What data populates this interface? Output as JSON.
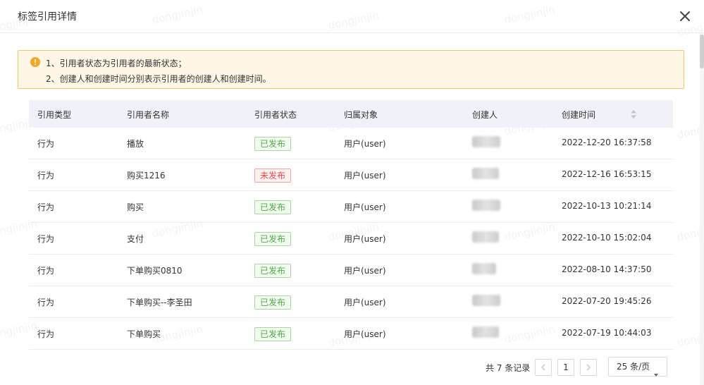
{
  "modal": {
    "title": "标签引用详情"
  },
  "watermark": "dongjinjin",
  "alert": {
    "lines": [
      "1、引用者状态为引用者的最新状态；",
      "2、创建人和创建时间分别表示引用者的创建人和创建时间。"
    ]
  },
  "table": {
    "columns": {
      "type": "引用类型",
      "name": "引用者名称",
      "status": "引用者状态",
      "owner": "归属对象",
      "creator": "创建人",
      "time": "创建时间"
    },
    "rows": [
      {
        "type": "行为",
        "name": "播放",
        "status": "已发布",
        "status_kind": "published",
        "owner": "用户(user)",
        "time": "2022-12-20 16:37:58"
      },
      {
        "type": "行为",
        "name": "购买1216",
        "status": "未发布",
        "status_kind": "unpublished",
        "owner": "用户(user)",
        "time": "2022-12-16 16:53:15"
      },
      {
        "type": "行为",
        "name": "购买",
        "status": "已发布",
        "status_kind": "published",
        "owner": "用户(user)",
        "time": "2022-10-13 10:21:14"
      },
      {
        "type": "行为",
        "name": "支付",
        "status": "已发布",
        "status_kind": "published",
        "owner": "用户(user)",
        "time": "2022-10-10 15:02:04"
      },
      {
        "type": "行为",
        "name": "下单购买0810",
        "status": "已发布",
        "status_kind": "published",
        "owner": "用户(user)",
        "time": "2022-08-10 14:37:50"
      },
      {
        "type": "行为",
        "name": "下单购买--李圣田",
        "status": "已发布",
        "status_kind": "published",
        "owner": "用户(user)",
        "time": "2022-07-20 19:45:26"
      },
      {
        "type": "行为",
        "name": "下单购买",
        "status": "已发布",
        "status_kind": "published",
        "owner": "用户(user)",
        "time": "2022-07-19 10:44:03"
      }
    ]
  },
  "pagination": {
    "total": "共 7 条记录",
    "current_page": "1",
    "page_size": "25 条/页"
  },
  "colors": {
    "alert_bg": "#fff7e6",
    "alert_border": "#f8c463",
    "warning_icon": "#f5a623",
    "published": "#52a84a",
    "unpublished": "#e5484d",
    "header_bg": "#f0f2f7"
  }
}
